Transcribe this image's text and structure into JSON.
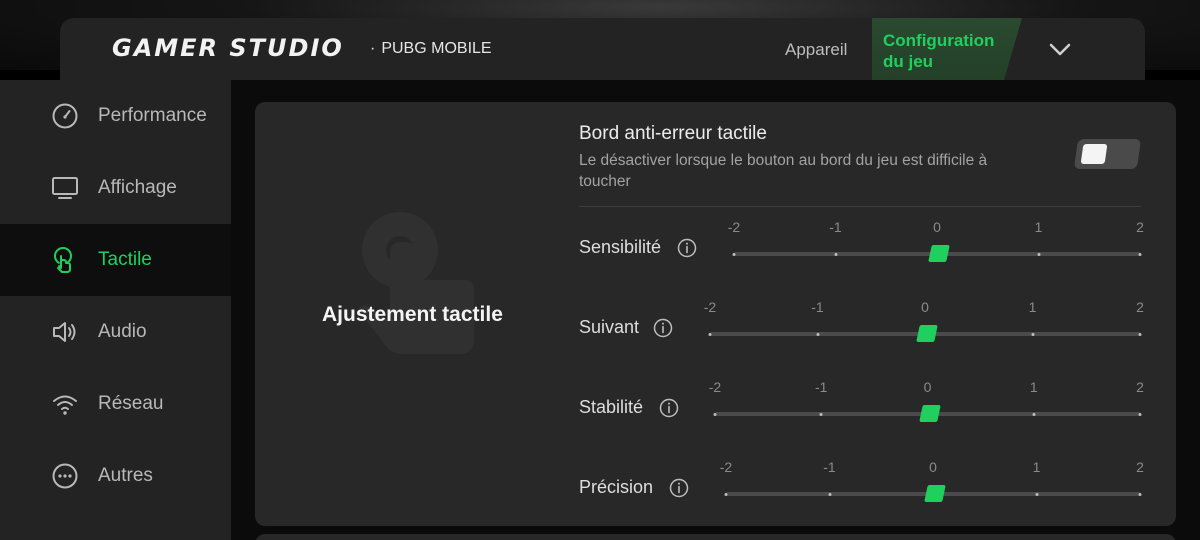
{
  "header": {
    "logo": "GAMER STUDIO",
    "separator": "·",
    "game": "PUBG MOBILE",
    "tab_device": "Appareil",
    "tab_config": "Configuration du jeu"
  },
  "sidebar": {
    "items": [
      {
        "label": "Performance",
        "icon": "gauge-icon"
      },
      {
        "label": "Affichage",
        "icon": "monitor-icon"
      },
      {
        "label": "Tactile",
        "icon": "touch-icon",
        "active": true
      },
      {
        "label": "Audio",
        "icon": "speaker-icon"
      },
      {
        "label": "Réseau",
        "icon": "wifi-icon"
      },
      {
        "label": "Autres",
        "icon": "more-icon"
      }
    ]
  },
  "main": {
    "section_title": "Ajustement tactile",
    "anti_error": {
      "title": "Bord anti-erreur tactile",
      "description": "Le désactiver lorsque le bouton au bord du jeu est difficile à toucher",
      "enabled": false
    },
    "sliders": [
      {
        "label": "Sensibilité",
        "ticks": [
          "-2",
          "-1",
          "0",
          "1",
          "2"
        ],
        "value": 0
      },
      {
        "label": "Suivant",
        "ticks": [
          "-2",
          "-1",
          "0",
          "1",
          "2"
        ],
        "value": 0
      },
      {
        "label": "Stabilité",
        "ticks": [
          "-2",
          "-1",
          "0",
          "1",
          "2"
        ],
        "value": 0
      },
      {
        "label": "Précision",
        "ticks": [
          "-2",
          "-1",
          "0",
          "1",
          "2"
        ],
        "value": 0
      }
    ]
  },
  "colors": {
    "accent": "#1fd05f",
    "panel": "#282828",
    "sidebar": "#232323"
  }
}
